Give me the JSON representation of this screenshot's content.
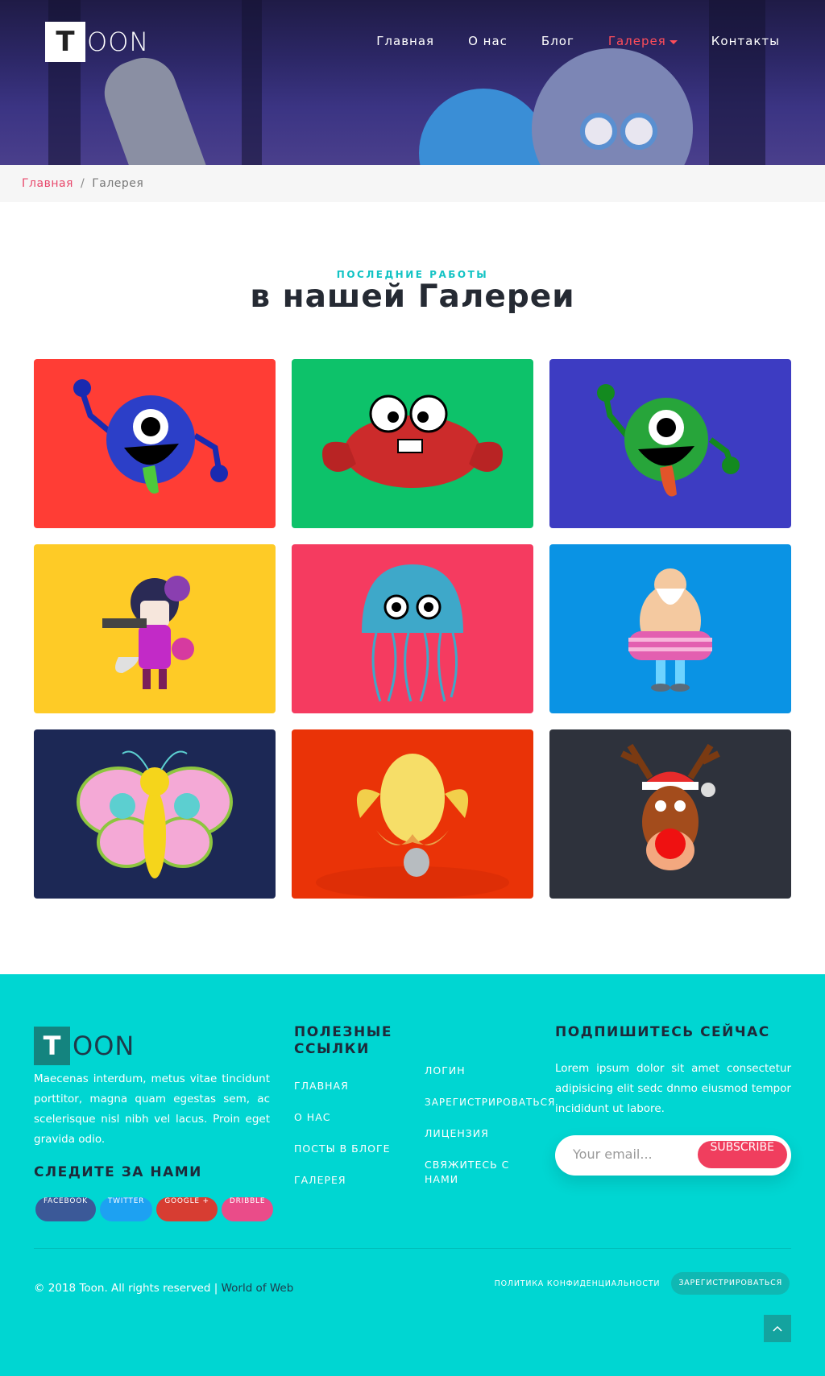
{
  "header": {
    "logo_letter": "T",
    "logo_rest": "OON",
    "nav": [
      {
        "label": "Главная"
      },
      {
        "label": "О нас"
      },
      {
        "label": "Блог"
      },
      {
        "label": "Галерея",
        "active": true
      },
      {
        "label": "Контакты"
      }
    ]
  },
  "breadcrumb": {
    "home": "Главная",
    "separator": "/",
    "current": "Галерея"
  },
  "section": {
    "eyebrow": "ПОСЛЕДНИЕ РАБОТЫ",
    "title": "в нашей Галереи"
  },
  "gallery": [
    {
      "bg": "#ff3d35",
      "icon": "blue-monster-icon"
    },
    {
      "bg": "#0dc26a",
      "icon": "crab-icon"
    },
    {
      "bg": "#3d3cc2",
      "icon": "green-monster-icon"
    },
    {
      "bg": "#fecb26",
      "icon": "girl-with-gun-icon"
    },
    {
      "bg": "#f53b60",
      "icon": "jellyfish-icon"
    },
    {
      "bg": "#0a93e4",
      "icon": "old-man-swimmer-icon"
    },
    {
      "bg": "#1c2855",
      "icon": "butterfly-icon"
    },
    {
      "bg": "#ea3307",
      "icon": "chick-with-egg-icon"
    },
    {
      "bg": "#2e323c",
      "icon": "reindeer-icon"
    }
  ],
  "footer": {
    "logo_letter": "T",
    "logo_rest": "OON",
    "description": "Maecenas interdum, metus vitae tincidunt porttitor, magna quam egestas sem, ac scelerisque nisl nibh vel lacus. Proin eget gravida odio.",
    "follow_heading": "СЛЕДИТЕ ЗА НАМИ",
    "socials": [
      {
        "label": "FACEBOOK",
        "color": "#3b5998"
      },
      {
        "label": "TWITTER",
        "color": "#1da1f2"
      },
      {
        "label": "GOOGLE +",
        "color": "#d73d32"
      },
      {
        "label": "DRIBBLE",
        "color": "#ea4c89"
      }
    ],
    "links_heading": "ПОЛЕЗНЫЕ ССЫЛКИ",
    "links_col1": [
      "ГЛАВНАЯ",
      "О НАС",
      "ПОСТЫ В БЛОГЕ",
      "ГАЛЕРЕЯ"
    ],
    "links_col2": [
      "ЛОГИН",
      "ЗАРЕГИСТРИРОВАТЬСЯ",
      "ЛИЦЕНЗИЯ",
      "СВЯЖИТЕСЬ С НАМИ"
    ],
    "subscribe_heading": "ПОДПИШИТЕСЬ СЕЙЧАС",
    "subscribe_text": "Lorem ipsum dolor sit amet consectetur adipisicing elit sedc dnmo eiusmod tempor incididunt ut labore.",
    "email_placeholder": "Your email...",
    "subscribe_button": "SUBSCRIBE",
    "copyright": "© 2018 Toon. All rights reserved | ",
    "copyright_link": "World of Web",
    "privacy": "ПОЛИТИКА КОНФИДЕНЦИАЛЬНОСТИ",
    "register": "ЗАРЕГИСТРИРОВАТЬСЯ"
  }
}
